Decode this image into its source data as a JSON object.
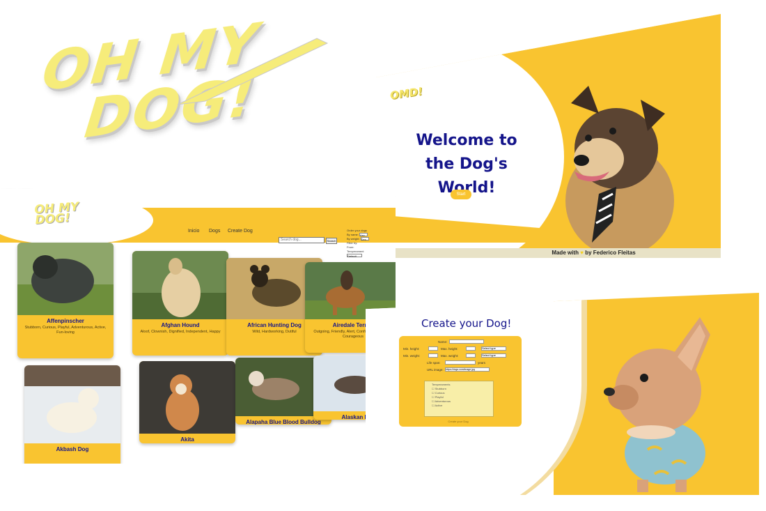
{
  "logo": {
    "line1": "OH MY",
    "line2": "DOG!",
    "mini": "OMD!",
    "header_line1": "OH MY",
    "header_line2": "DOG!"
  },
  "welcome": {
    "title_line1": "Welcome to",
    "title_line2": "the Dog's World!",
    "button": "Start",
    "footer_prefix": "Made with",
    "footer_heart": "♥",
    "footer_suffix": "by Federico Fleitas"
  },
  "home": {
    "nav": [
      "Inicio",
      "Dogs",
      "Create Dog"
    ],
    "search": {
      "placeholder": "Search dog...",
      "button": "Search"
    },
    "filters": {
      "lines": [
        "Order your dogs",
        "By name:",
        "By weight:",
        "Filter by:",
        "From:",
        "Temperament"
      ],
      "sort_options": [
        "Asc",
        "Des"
      ],
      "default_option": "Default"
    },
    "cards": [
      {
        "name": "Affenpinscher",
        "temperament": "Stubborn, Curious, Playful, Adventurous, Active, Fun-loving",
        "color": "#49504a"
      },
      {
        "name": "Afghan Hound",
        "temperament": "Aloof, Clownish, Dignified, Independent, Happy",
        "color": "#d8b987"
      },
      {
        "name": "African Hunting Dog",
        "temperament": "Wild, Hardworking, Dutiful",
        "color": "#6b5632"
      },
      {
        "name": "Airedale Terrier",
        "temperament": "Outgoing, Friendly, Alert, Confident, Intelligent, Courageous",
        "color": "#9a6a36"
      },
      {
        "name": "Akbash Dog",
        "temperament": "",
        "color": "#f2efe6"
      },
      {
        "name": "Akita",
        "temperament": "",
        "color": "#cf8a45"
      },
      {
        "name": "Alapaha Blue Blood Bulldog",
        "temperament": "",
        "color": "#8e7a64"
      },
      {
        "name": "Alaskan Husky",
        "temperament": "",
        "color": "#6c5c4f"
      }
    ]
  },
  "create": {
    "title": "Create your Dog!",
    "labels": {
      "name": "Name:",
      "min_height": "Min. height:",
      "max_height": "Max. height:",
      "min_weight": "Min. weight:",
      "max_weight": "Max. weight:",
      "life_span": "Life span:",
      "years": "years",
      "url": "URL image:",
      "url_value": "https://dogs.com/image.jpg",
      "select": "Select type",
      "temperaments_title": "Temperaments",
      "button": "Create your Dog"
    },
    "temperaments": [
      "Stubborn",
      "Curious",
      "Playful",
      "Adventurous",
      "Active"
    ]
  },
  "colors": {
    "accent": "#f9c430",
    "navy": "#14148a",
    "logo": "#f6ec7a"
  }
}
